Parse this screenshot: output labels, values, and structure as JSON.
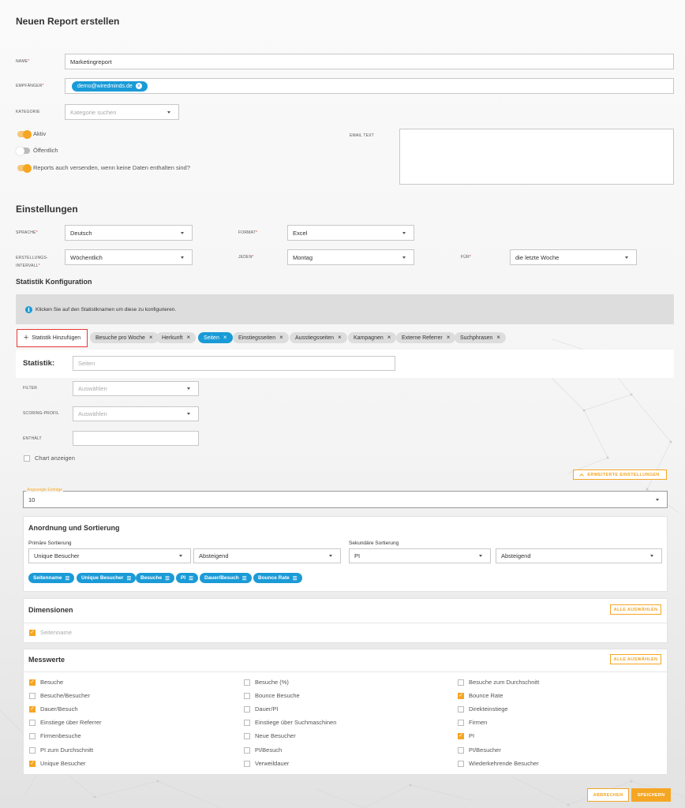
{
  "page": {
    "title": "Neuen Report erstellen"
  },
  "form": {
    "name_label": "NAME",
    "name_value": "Marketingreport",
    "recipient_label": "EMPFÄNGER",
    "recipient_chip": "demo@wiredminds.de",
    "category_label": "KATEGORIE",
    "category_placeholder": "Kategorie suchen",
    "toggle_active": "Aktiv",
    "toggle_public": "Öffentlich",
    "toggle_send_empty": "Reports auch versenden, wenn keine Daten enthalten sind?",
    "email_text_label": "EMAIL TEXT",
    "required_mark": "*"
  },
  "settings": {
    "title": "Einstellungen",
    "language_label": "SPRACHE",
    "language_value": "Deutsch",
    "format_label": "FORMAT",
    "format_value": "Excel",
    "interval_label_1": "ERSTELLUNGS-",
    "interval_label_2": "INTERVALL",
    "interval_value": "Wöchentlich",
    "every_label": "JEDEN",
    "every_value": "Montag",
    "for_label": "FÜR",
    "for_value": "die letzte Woche"
  },
  "stat_config": {
    "title": "Statistik Konfiguration",
    "info_icon": "info-icon",
    "info_text": "Klicken Sie auf den Statistiknamen um diese zu konfigurieren.",
    "add_button": "Statistik Hinzufügen",
    "add_icon": "plus",
    "tabs": [
      {
        "label": "Besuche pro Woche",
        "active": false
      },
      {
        "label": "Herkunft",
        "active": false
      },
      {
        "label": "Seiten",
        "active": true
      },
      {
        "label": "Einstiegsseiten",
        "active": false
      },
      {
        "label": "Ausstiegsseiten",
        "active": false
      },
      {
        "label": "Kampagnen",
        "active": false
      },
      {
        "label": "Externe Referrer",
        "active": false
      },
      {
        "label": "Suchphrasen",
        "active": false
      }
    ],
    "close_glyph": "×"
  },
  "statistic": {
    "label": "Statistik:",
    "placeholder": "Seiten",
    "filter_label": "FILTER",
    "filter_placeholder": "Auswählen",
    "scoring_label": "SCORING-PROFIL",
    "scoring_placeholder": "Auswählen",
    "contains_label": "ENTHÄLT",
    "chart_checkbox": "Chart anzeigen",
    "advanced_button": "Erweiterte Einstellungen",
    "entries_label": "Angezeigte Einträge",
    "entries_value": "10"
  },
  "sorting": {
    "title": "Anordnung und Sortierung",
    "primary_label": "Primäre Sortierung",
    "primary_value": "Unique Besucher",
    "primary_order": "Absteigend",
    "secondary_label": "Sekundäre Sortierung",
    "secondary_value": "PI",
    "secondary_order": "Absteigend",
    "columns": [
      "Seitenname",
      "Unique Besucher",
      "Besuche",
      "PI",
      "Dauer/Besuch",
      "Bounce Rate"
    ],
    "column_icon": "grip-icon"
  },
  "dimensions": {
    "title": "Dimensionen",
    "select_all": "Alle auswählen",
    "items": [
      {
        "label": "Seitenname",
        "checked": true
      }
    ]
  },
  "metrics": {
    "title": "Messwerte",
    "select_all": "Alle auswählen",
    "columns": [
      [
        {
          "label": "Besuche",
          "checked": true
        },
        {
          "label": "Besuche/Besucher",
          "checked": false
        },
        {
          "label": "Dauer/Besuch",
          "checked": true
        },
        {
          "label": "Einstiege über Referrer",
          "checked": false
        },
        {
          "label": "Firmenbesuche",
          "checked": false
        },
        {
          "label": "PI zum Durchschnitt",
          "checked": false
        },
        {
          "label": "Unique Besucher",
          "checked": true
        }
      ],
      [
        {
          "label": "Besuche (%)",
          "checked": false
        },
        {
          "label": "Bounce Besuche",
          "checked": false
        },
        {
          "label": "Dauer/PI",
          "checked": false
        },
        {
          "label": "Einstiege über Suchmaschinen",
          "checked": false
        },
        {
          "label": "Neue Besucher",
          "checked": false
        },
        {
          "label": "PI/Besuch",
          "checked": false
        },
        {
          "label": "Verweildauer",
          "checked": false
        }
      ],
      [
        {
          "label": "Besuche zum Durchschnitt",
          "checked": false
        },
        {
          "label": "Bounce Rate",
          "checked": true
        },
        {
          "label": "Direkteinstiege",
          "checked": false
        },
        {
          "label": "Firmen",
          "checked": false
        },
        {
          "label": "PI",
          "checked": true
        },
        {
          "label": "PI/Besucher",
          "checked": false
        },
        {
          "label": "Wiederkehrende Besucher",
          "checked": false
        }
      ]
    ]
  },
  "footer": {
    "cancel": "Abbrechen",
    "save": "Speichern"
  },
  "colors": {
    "accent": "#f5a623",
    "blue": "#1a9bd7",
    "highlight": "#e53935"
  }
}
